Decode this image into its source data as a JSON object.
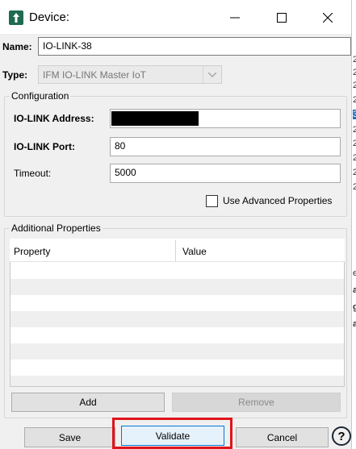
{
  "window": {
    "title": "Device:",
    "icon": "device-app-icon",
    "controls": [
      "minimize-icon",
      "maximize-icon",
      "close-icon"
    ]
  },
  "form": {
    "name_label": "Name:",
    "name_value": "IO-LINK-38",
    "type_label": "Type:",
    "type_value": "IFM IO-LINK Master IoT"
  },
  "configuration": {
    "legend": "Configuration",
    "address_label": "IO-LINK Address:",
    "address_value": "",
    "port_label": "IO-LINK Port:",
    "port_value": "80",
    "timeout_label": "Timeout:",
    "timeout_value": "5000",
    "advanced_label": "Use Advanced Properties",
    "advanced_checked": false
  },
  "additional_properties": {
    "legend": "Additional Properties",
    "columns": [
      "Property",
      "Value"
    ],
    "rows": [],
    "add_label": "Add",
    "remove_label": "Remove"
  },
  "footer": {
    "save_label": "Save",
    "validate_label": "Validate",
    "cancel_label": "Cancel",
    "help_label": "?"
  },
  "background_strip": {
    "digits": [
      "2",
      "2",
      "2",
      "2",
      "3",
      "2",
      "2",
      "2",
      "2",
      "2",
      "e",
      "a",
      "g",
      "a"
    ]
  },
  "colors": {
    "highlight": "#e0141b",
    "focus_border": "#0078d7",
    "icon_green": "#1f6b50"
  }
}
